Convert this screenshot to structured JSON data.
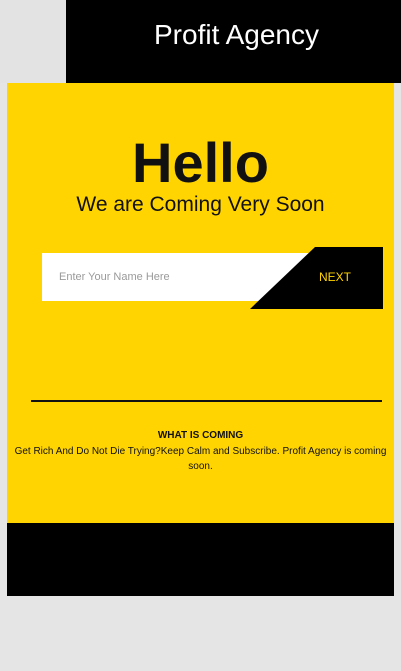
{
  "header": {
    "brand": "Profit Agency"
  },
  "hero": {
    "headline": "Hello",
    "tagline": "We are Coming Very Soon"
  },
  "signup": {
    "placeholder": "Enter Your Name Here",
    "button_label": "NEXT"
  },
  "info": {
    "title": "WHAT IS COMING",
    "text": "Get Rich And Do Not Die Trying?Keep Calm and Subscribe. Profit Agency is coming soon."
  },
  "colors": {
    "accent": "#ffd400",
    "dark": "#000000",
    "background": "#e5e5e5"
  }
}
